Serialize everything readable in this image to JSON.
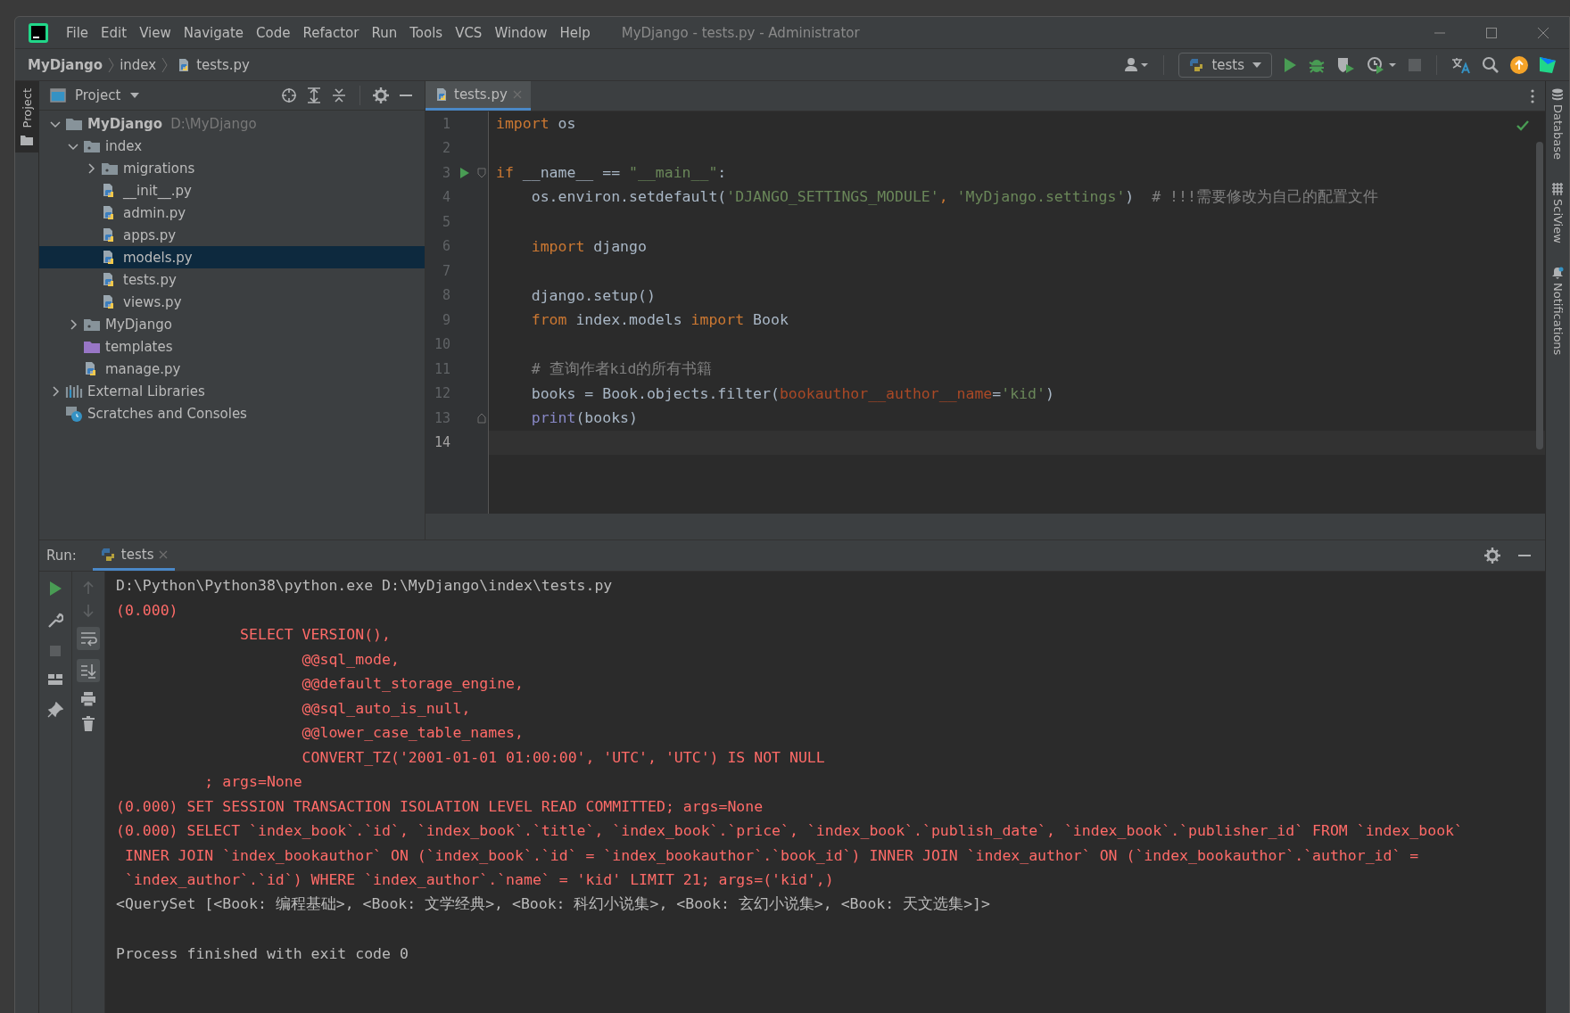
{
  "window": {
    "title": "MyDjango - tests.py - Administrator"
  },
  "menu": [
    "File",
    "Edit",
    "View",
    "Navigate",
    "Code",
    "Refactor",
    "Run",
    "Tools",
    "VCS",
    "Window",
    "Help"
  ],
  "breadcrumb": [
    "MyDjango",
    "index",
    "tests.py"
  ],
  "run_config": {
    "label": "tests"
  },
  "left_stripe": {
    "label": "Project"
  },
  "right_stripe": [
    "Database",
    "SciView",
    "Notifications"
  ],
  "project": {
    "title": "Project",
    "tree": [
      {
        "label": "MyDjango",
        "hint": "D:\\MyDjango",
        "kind": "project-root",
        "expanded": true,
        "selected": false,
        "children": [
          {
            "label": "index",
            "kind": "package",
            "expanded": true,
            "selected": false,
            "children": [
              {
                "label": "migrations",
                "kind": "package",
                "expanded": false,
                "selected": false
              },
              {
                "label": "__init__.py",
                "kind": "file",
                "selected": false
              },
              {
                "label": "admin.py",
                "kind": "file",
                "selected": false
              },
              {
                "label": "apps.py",
                "kind": "file",
                "selected": false
              },
              {
                "label": "models.py",
                "kind": "file",
                "selected": true
              },
              {
                "label": "tests.py",
                "kind": "file",
                "selected": false
              },
              {
                "label": "views.py",
                "kind": "file",
                "selected": false
              }
            ]
          },
          {
            "label": "MyDjango",
            "kind": "package",
            "expanded": false,
            "selected": false
          },
          {
            "label": "templates",
            "kind": "templates",
            "selected": false
          },
          {
            "label": "manage.py",
            "kind": "file",
            "selected": false
          }
        ]
      },
      {
        "label": "External Libraries",
        "kind": "libraries",
        "expanded": false,
        "selected": false
      },
      {
        "label": "Scratches and Consoles",
        "kind": "scratches",
        "selected": false
      }
    ]
  },
  "editor": {
    "tabs": [
      {
        "label": "tests.py",
        "selected": true
      }
    ],
    "lines": [
      {
        "number": "1",
        "tokens": [
          {
            "text": "import",
            "kind": "keyword"
          },
          {
            "text": " os",
            "kind": "plain"
          }
        ]
      },
      {
        "number": "2"
      },
      {
        "number": "3",
        "run_marker": true,
        "fold": true,
        "tokens": [
          {
            "text": "if",
            "kind": "keyword"
          },
          {
            "text": " __name__ == ",
            "kind": "plain"
          },
          {
            "text": "\"__main__\"",
            "kind": "string"
          },
          {
            "text": ":",
            "kind": "plain"
          }
        ]
      },
      {
        "number": "4",
        "tokens": [
          {
            "text": "    os.environ.setdefault(",
            "kind": "plain"
          },
          {
            "text": "'DJANGO_SETTINGS_MODULE'",
            "kind": "string"
          },
          {
            "text": ", ",
            "kind": "keyword"
          },
          {
            "text": "'MyDjango.settings'",
            "kind": "string"
          },
          {
            "text": ")  ",
            "kind": "plain"
          },
          {
            "text": "# !!!需要修改为自己的配置文件",
            "kind": "comment"
          }
        ]
      },
      {
        "number": "5"
      },
      {
        "number": "6",
        "tokens": [
          {
            "text": "    import",
            "kind": "keyword"
          },
          {
            "text": " django",
            "kind": "plain"
          }
        ]
      },
      {
        "number": "7"
      },
      {
        "number": "8",
        "tokens": [
          {
            "text": "    django.setup()",
            "kind": "plain"
          }
        ]
      },
      {
        "number": "9",
        "tokens": [
          {
            "text": "    from",
            "kind": "keyword"
          },
          {
            "text": " index.models ",
            "kind": "plain"
          },
          {
            "text": "import",
            "kind": "keyword"
          },
          {
            "text": " Book",
            "kind": "plain"
          }
        ]
      },
      {
        "number": "10"
      },
      {
        "number": "11",
        "tokens": [
          {
            "text": "    # 查询作者kid的所有书籍",
            "kind": "comment"
          }
        ]
      },
      {
        "number": "12",
        "tokens": [
          {
            "text": "    books = Book.objects.filter(",
            "kind": "plain"
          },
          {
            "text": "bookauthor__author__name",
            "kind": "param"
          },
          {
            "text": "=",
            "kind": "plain"
          },
          {
            "text": "'kid'",
            "kind": "string"
          },
          {
            "text": ")",
            "kind": "plain"
          }
        ]
      },
      {
        "number": "13",
        "fold": true,
        "tokens": [
          {
            "text": "    print",
            "kind": "builtin"
          },
          {
            "text": "(books)",
            "kind": "plain"
          }
        ]
      },
      {
        "number": "14",
        "current": true
      }
    ]
  },
  "run": {
    "label": "Run:",
    "tabs": [
      {
        "label": "tests",
        "selected": true
      }
    ],
    "console": [
      {
        "text": "D:\\Python\\Python38\\python.exe D:\\MyDjango\\index\\tests.py",
        "kind": "output"
      },
      {
        "text": "(0.000)",
        "kind": "sql"
      },
      {
        "text": "              SELECT VERSION(),",
        "kind": "sql"
      },
      {
        "text": "                     @@sql_mode,",
        "kind": "sql"
      },
      {
        "text": "                     @@default_storage_engine,",
        "kind": "sql"
      },
      {
        "text": "                     @@sql_auto_is_null,",
        "kind": "sql"
      },
      {
        "text": "                     @@lower_case_table_names,",
        "kind": "sql"
      },
      {
        "text": "                     CONVERT_TZ('2001-01-01 01:00:00', 'UTC', 'UTC') IS NOT NULL",
        "kind": "sql"
      },
      {
        "text": "          ; args=None",
        "kind": "sql"
      },
      {
        "text": "(0.000) SET SESSION TRANSACTION ISOLATION LEVEL READ COMMITTED; args=None",
        "kind": "sql"
      },
      {
        "text": "(0.000) SELECT `index_book`.`id`, `index_book`.`title`, `index_book`.`price`, `index_book`.`publish_date`, `index_book`.`publisher_id` FROM `index_book`",
        "kind": "sql"
      },
      {
        "text": " INNER JOIN `index_bookauthor` ON (`index_book`.`id` = `index_bookauthor`.`book_id`) INNER JOIN `index_author` ON (`index_bookauthor`.`author_id` =",
        "kind": "sql"
      },
      {
        "text": " `index_author`.`id`) WHERE `index_author`.`name` = 'kid' LIMIT 21; args=('kid',)",
        "kind": "sql"
      },
      {
        "text": "<QuerySet [<Book: 编程基础>, <Book: 文学经典>, <Book: 科幻小说集>, <Book: 玄幻小说集>, <Book: 天文选集>]>",
        "kind": "output"
      },
      {
        "text": "Process finished with exit code 0",
        "kind": "status"
      }
    ]
  }
}
